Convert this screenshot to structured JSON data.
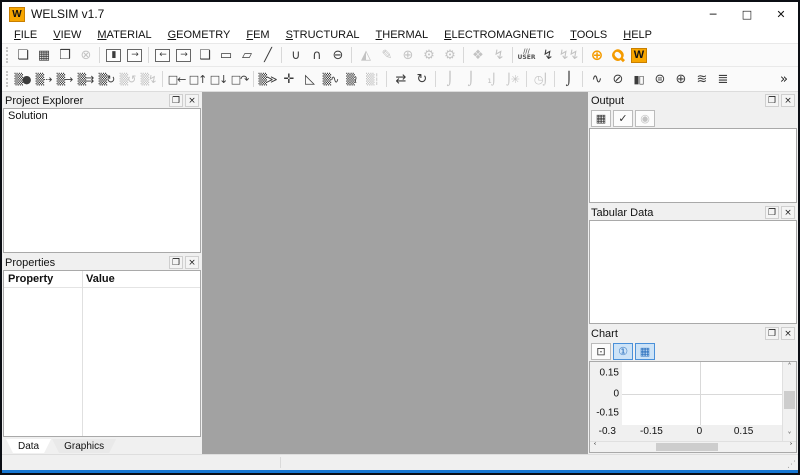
{
  "window": {
    "title": "WELSIM v1.7",
    "logo_letter": "W",
    "controls": {
      "minimize": "─",
      "maximize": "□",
      "close": "✕"
    }
  },
  "panel_buttons": {
    "float": "❐",
    "close": "×"
  },
  "menu": {
    "items": [
      {
        "name": "menu-file",
        "hot": "F",
        "rest": "ILE"
      },
      {
        "name": "menu-view",
        "hot": "V",
        "rest": "IEW"
      },
      {
        "name": "menu-material",
        "hot": "M",
        "rest": "ATERIAL"
      },
      {
        "name": "menu-geometry",
        "hot": "G",
        "rest": "EOMETRY"
      },
      {
        "name": "menu-fem",
        "hot": "F",
        "rest": "EM"
      },
      {
        "name": "menu-structural",
        "hot": "S",
        "rest": "TRUCTURAL"
      },
      {
        "name": "menu-thermal",
        "hot": "T",
        "rest": "HERMAL"
      },
      {
        "name": "menu-electromagnetic",
        "hot": "E",
        "rest": "LECTROMAGNETIC"
      },
      {
        "name": "menu-tools",
        "hot": "T",
        "rest": "OOLS"
      },
      {
        "name": "menu-help",
        "hot": "H",
        "rest": "ELP"
      }
    ]
  },
  "toolbar1": {
    "icons": [
      {
        "name": "toolbar-drag-handle",
        "cls": "handle",
        "inter": false
      },
      {
        "name": "new-file-button",
        "glyph": "❏"
      },
      {
        "name": "save-button",
        "glyph": "▦"
      },
      {
        "name": "open-button",
        "glyph": "❒"
      },
      {
        "name": "close-project-button",
        "glyph": "⊗",
        "cls": "dis"
      },
      {
        "name": "separator",
        "cls": "sep",
        "inter": false
      },
      {
        "name": "import-button",
        "glyph": "▮",
        "cls": "framed"
      },
      {
        "name": "export-button",
        "glyph": "→",
        "cls": "framed"
      },
      {
        "name": "separator",
        "cls": "sep",
        "inter": false
      },
      {
        "name": "view-prev-button",
        "glyph": "←",
        "cls": "framed"
      },
      {
        "name": "view-next-button",
        "glyph": "→",
        "cls": "framed"
      },
      {
        "name": "solid-box-button",
        "glyph": "❑"
      },
      {
        "name": "eraser-button",
        "glyph": "▭"
      },
      {
        "name": "plane-button",
        "glyph": "▱"
      },
      {
        "name": "line-button",
        "glyph": "╱"
      },
      {
        "name": "separator",
        "cls": "sep",
        "inter": false
      },
      {
        "name": "bool-union-button",
        "glyph": "∪"
      },
      {
        "name": "bool-intersect-button",
        "glyph": "∩"
      },
      {
        "name": "bool-subtract-button",
        "glyph": "⊖"
      },
      {
        "name": "separator",
        "cls": "sep",
        "inter": false
      },
      {
        "name": "mesh-generate-button",
        "glyph": "◭",
        "cls": "dis"
      },
      {
        "name": "mesh-clean-button",
        "glyph": "✎",
        "cls": "dis"
      },
      {
        "name": "mesh-inspect-button",
        "glyph": "⊕",
        "cls": "dis"
      },
      {
        "name": "mesh-settings-button",
        "glyph": "⚙",
        "cls": "dis"
      },
      {
        "name": "mesh-quality-button",
        "glyph": "⚙",
        "cls": "dis"
      },
      {
        "name": "separator",
        "cls": "sep",
        "inter": false
      },
      {
        "name": "layers-button",
        "glyph": "❖",
        "cls": "dis"
      },
      {
        "name": "solve-button",
        "glyph": "↯",
        "cls": "dis"
      },
      {
        "name": "separator",
        "cls": "sep",
        "inter": false
      },
      {
        "name": "user-defined-button",
        "glyph": "///\nUSER",
        "cls": "user"
      },
      {
        "name": "run-analysis-button",
        "glyph": "↯"
      },
      {
        "name": "run-all-button",
        "glyph": "↯↯",
        "cls": "dis"
      },
      {
        "name": "separator",
        "cls": "sep",
        "inter": false
      },
      {
        "name": "web-globe-button",
        "glyph": "⊕",
        "cls": "orange"
      },
      {
        "name": "search-button",
        "glyph": "Ϙ",
        "cls": "orange mag"
      },
      {
        "name": "welsim-logo-button",
        "glyph": "W",
        "cls": "wlogo"
      }
    ]
  },
  "toolbar2": {
    "icons": [
      {
        "name": "toolbar-drag-handle",
        "cls": "handle",
        "inter": false
      },
      {
        "name": "fixed-support-button",
        "glyph": "▒●",
        "cls": "pair"
      },
      {
        "name": "displacement-button",
        "glyph": "▒⇢",
        "cls": "pair"
      },
      {
        "name": "force-button",
        "glyph": "▒→",
        "cls": "pair"
      },
      {
        "name": "pressure-load-button",
        "glyph": "▒⇉",
        "cls": "pair"
      },
      {
        "name": "rotation-button",
        "glyph": "▒↻",
        "cls": "pair"
      },
      {
        "name": "rotational-velocity-button",
        "glyph": "▒↺",
        "cls": "pair dis"
      },
      {
        "name": "moment-button",
        "glyph": "▒↯",
        "cls": "pair dis"
      },
      {
        "name": "separator",
        "cls": "sep",
        "inter": false
      },
      {
        "name": "translate-x-button",
        "glyph": "□←",
        "cls": "pair"
      },
      {
        "name": "translate-y-button",
        "glyph": "□↑",
        "cls": "pair"
      },
      {
        "name": "translate-z-button",
        "glyph": "□↓",
        "cls": "pair"
      },
      {
        "name": "rotate-body-button",
        "glyph": "□↷",
        "cls": "pair"
      },
      {
        "name": "separator",
        "cls": "sep",
        "inter": false
      },
      {
        "name": "distributed-load-button",
        "glyph": "▒≫",
        "cls": "pair"
      },
      {
        "name": "node-force-button",
        "glyph": "✛"
      },
      {
        "name": "frictionless-support-button",
        "glyph": "◺"
      },
      {
        "name": "elastic-support-button",
        "glyph": "▒∿",
        "cls": "pair"
      },
      {
        "name": "compression-support-button",
        "glyph": "▒≀",
        "cls": "pair"
      },
      {
        "name": "remote-displacement-button",
        "glyph": "▒┆",
        "cls": "pair dis"
      },
      {
        "name": "separator",
        "cls": "sep",
        "inter": false
      },
      {
        "name": "import-loads-button",
        "glyph": "⇄"
      },
      {
        "name": "refresh-button",
        "glyph": "↻"
      },
      {
        "name": "separator",
        "cls": "sep",
        "inter": false
      },
      {
        "name": "temperature-button",
        "glyph": "⌡",
        "cls": "dis"
      },
      {
        "name": "temperature-surface-button",
        "glyph": "⌡",
        "cls": "dis"
      },
      {
        "name": "temperature-node-button",
        "glyph": "₁⌡",
        "cls": "pair dis"
      },
      {
        "name": "radiation-button",
        "glyph": "⌡✳",
        "cls": "pair dis"
      },
      {
        "name": "separator",
        "cls": "sep",
        "inter": false
      },
      {
        "name": "transient-thermal-button",
        "glyph": "◷⌡",
        "cls": "pair dis"
      },
      {
        "name": "separator",
        "cls": "sep",
        "inter": false
      },
      {
        "name": "thermal-condition-button",
        "glyph": "⌡",
        "cls": "temp-on"
      },
      {
        "name": "separator",
        "cls": "sep",
        "inter": false
      },
      {
        "name": "coil-conductor-button",
        "glyph": "∿"
      },
      {
        "name": "magnetic-disc-button",
        "glyph": "⊘"
      },
      {
        "name": "capacitor-button",
        "glyph": "▮▯",
        "cls": "pair"
      },
      {
        "name": "conductor-sphere-button",
        "glyph": "⊜"
      },
      {
        "name": "mesh-sphere-button",
        "glyph": "⊕"
      },
      {
        "name": "antenna-button",
        "glyph": "≋"
      },
      {
        "name": "transformer-button",
        "glyph": "≣"
      },
      {
        "name": "toolbar-overflow-button",
        "glyph": "»",
        "cls": "overflow"
      }
    ]
  },
  "panels": {
    "project_explorer": {
      "title": "Project Explorer",
      "items": [
        "Solution"
      ]
    },
    "properties": {
      "title": "Properties",
      "columns": [
        "Property",
        "Value"
      ]
    },
    "bottom_tabs": [
      {
        "name": "tab-data",
        "label": "Data",
        "cls": "active"
      },
      {
        "name": "tab-graphics",
        "label": "Graphics"
      }
    ],
    "output": {
      "title": "Output",
      "toolbar": [
        {
          "name": "save-output-button",
          "glyph": "▦"
        },
        {
          "name": "clear-output-button",
          "glyph": "✓"
        },
        {
          "name": "stop-button",
          "glyph": "◉",
          "cls": "dis"
        }
      ]
    },
    "tabular_data": {
      "title": "Tabular Data"
    },
    "chart": {
      "title": "Chart",
      "toolbar": [
        {
          "name": "chart-fit-button",
          "glyph": "⊡"
        },
        {
          "name": "chart-points-button",
          "glyph": "①",
          "cls": "active"
        },
        {
          "name": "chart-grid-button",
          "glyph": "▦",
          "cls": "active"
        }
      ],
      "scroll": {
        "up": "˄",
        "down": "˅",
        "left": "˂",
        "right": "˃"
      }
    }
  },
  "chart_data": {
    "type": "line",
    "series": [],
    "y_ticks": [
      "0.15",
      "0",
      "-0.15"
    ],
    "x_ticks": [
      "-0.3",
      "-0.15",
      "0",
      "0.15"
    ],
    "xlim": [
      -0.35,
      0.25
    ],
    "ylim": [
      -0.22,
      0.22
    ],
    "grid": true
  },
  "statusbar": {
    "grip": "⋰"
  }
}
